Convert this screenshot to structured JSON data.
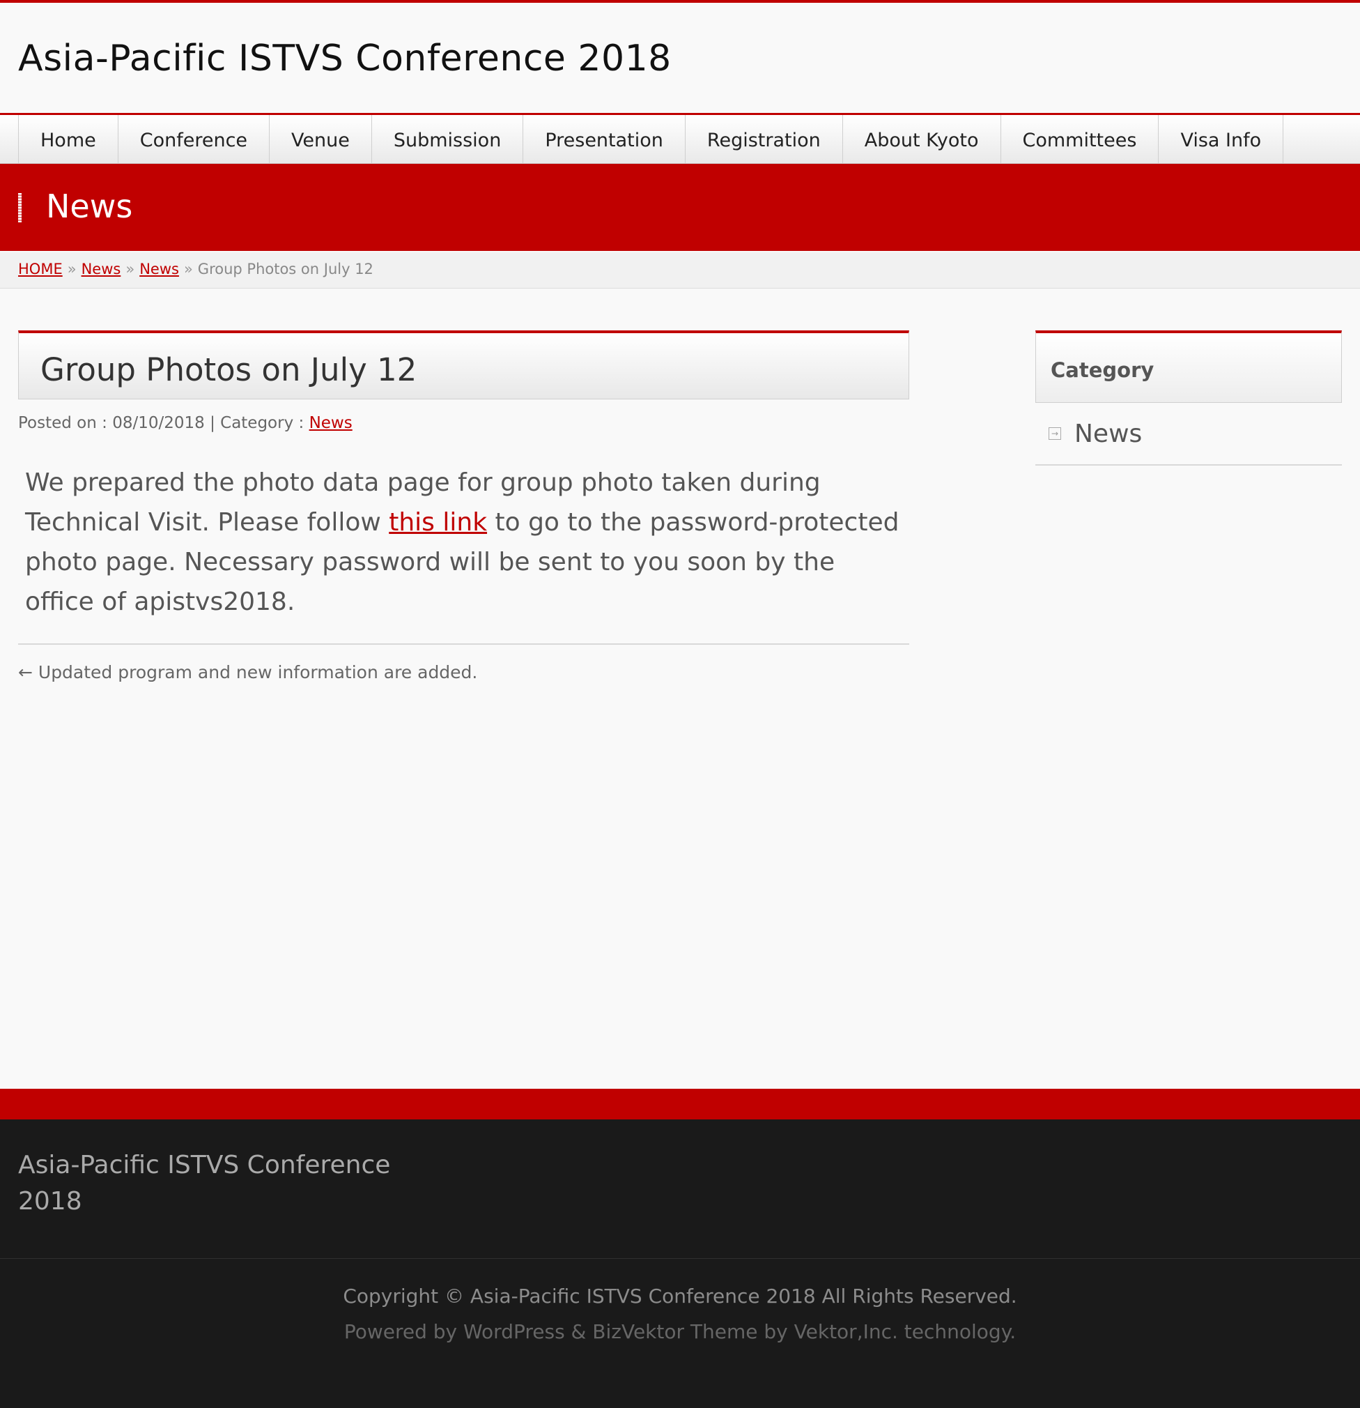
{
  "header": {
    "site_title": "Asia-Pacific ISTVS Conference 2018"
  },
  "nav": {
    "items": [
      {
        "label": "Home"
      },
      {
        "label": "Conference"
      },
      {
        "label": "Venue"
      },
      {
        "label": "Submission"
      },
      {
        "label": "Presentation"
      },
      {
        "label": "Registration"
      },
      {
        "label": "About Kyoto"
      },
      {
        "label": "Committees"
      },
      {
        "label": "Visa Info"
      }
    ]
  },
  "banner": {
    "label": "News"
  },
  "breadcrumb": {
    "items": [
      "HOME",
      "News",
      "News"
    ],
    "separator": "»",
    "current": "Group Photos on July 12"
  },
  "post": {
    "title": "Group Photos on July 12",
    "meta_prefix": "Posted on : 08/10/2018 | Category : ",
    "category": "News",
    "body_before_link": "We prepared the photo data page for group photo taken during Technical Visit. Please follow ",
    "link_text": "this link",
    "body_after_link": " to go to the password-protected photo page. Necessary password will be sent to you soon by the office of apistvs2018.",
    "prev_link": "← Updated program and new information are added."
  },
  "sidebar": {
    "heading": "Category",
    "items": [
      {
        "label": "News",
        "icon": "arrow-box-icon"
      }
    ]
  },
  "footer": {
    "site_name": "Asia-Pacific ISTVS Conference 2018",
    "copyright": "Copyright © Asia-Pacific ISTVS Conference 2018 All Rights Reserved.",
    "powered": "Powered by WordPress & BizVektor Theme by Vektor,Inc. technology."
  },
  "colors": {
    "accent": "#c00000",
    "footer_bg": "#1a1a1a",
    "page_bg": "#f9f9f9"
  }
}
